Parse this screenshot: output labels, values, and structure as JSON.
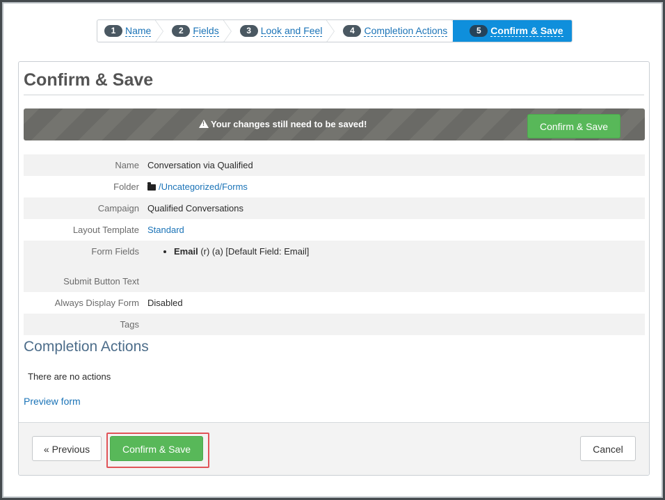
{
  "wizard": {
    "steps": [
      {
        "num": "1",
        "label": "Name"
      },
      {
        "num": "2",
        "label": "Fields"
      },
      {
        "num": "3",
        "label": "Look and Feel"
      },
      {
        "num": "4",
        "label": "Completion Actions"
      },
      {
        "num": "5",
        "label": "Confirm & Save"
      }
    ],
    "active_step": "5"
  },
  "page_title": "Confirm & Save",
  "alert": {
    "icon": "warning-icon",
    "message": "Your changes still need to be saved!",
    "button_label": "Confirm & Save"
  },
  "summary": {
    "name": {
      "label": "Name",
      "value": "Conversation via Qualified"
    },
    "folder": {
      "label": "Folder",
      "icon": "folder-icon",
      "parts": [
        "Uncategorized",
        "Forms"
      ],
      "separator": "/"
    },
    "campaign": {
      "label": "Campaign",
      "value": "Qualified Conversations"
    },
    "layout_template": {
      "label": "Layout Template",
      "value": "Standard"
    },
    "form_fields": {
      "label": "Form Fields",
      "items": [
        {
          "name": "Email",
          "details": "(r) (a) [Default Field: Email]"
        }
      ]
    },
    "submit_button_text": {
      "label": "Submit Button Text",
      "value": ""
    },
    "always_display_form": {
      "label": "Always Display Form",
      "value": "Disabled"
    },
    "tags": {
      "label": "Tags",
      "value": ""
    }
  },
  "completion_actions": {
    "title": "Completion Actions",
    "empty_text": "There are no actions"
  },
  "preview_link": "Preview form",
  "footer": {
    "previous_label": "« Previous",
    "confirm_label": "Confirm & Save",
    "cancel_label": "Cancel"
  },
  "colors": {
    "accent_blue": "#0f8fdc",
    "link_blue": "#1a73b7",
    "save_green": "#58b859",
    "highlight_red": "#e05358"
  }
}
